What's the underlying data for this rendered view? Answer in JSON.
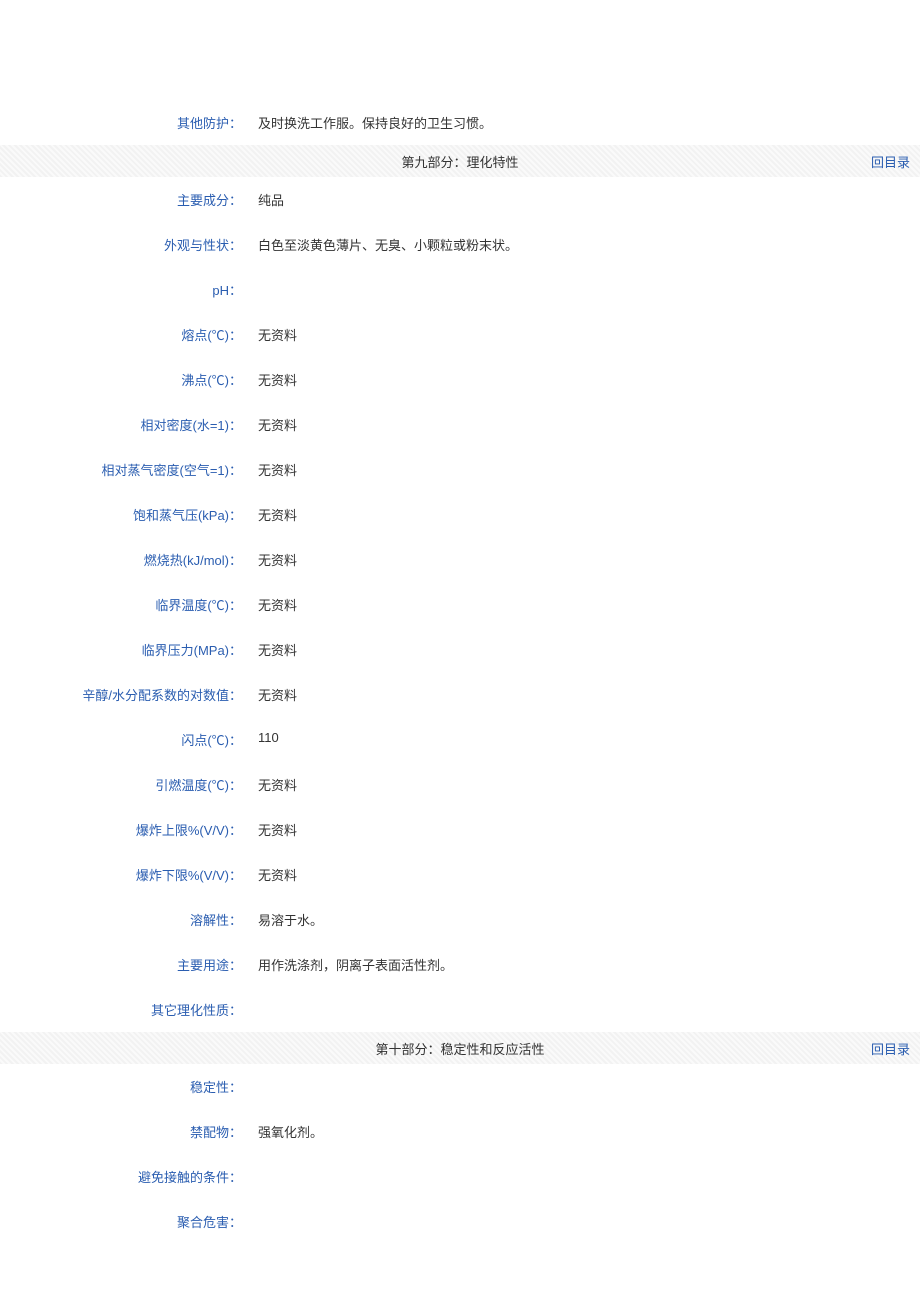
{
  "top_row": {
    "label": "其他防护：",
    "value": "及时换洗工作服。保持良好的卫生习惯。"
  },
  "section9": {
    "title": "第九部分：理化特性",
    "back": "回目录",
    "rows": [
      {
        "label": "主要成分：",
        "value": "纯品"
      },
      {
        "label": "外观与性状：",
        "value": "白色至淡黄色薄片、无臭、小颗粒或粉末状。"
      },
      {
        "label": "pH：",
        "value": ""
      },
      {
        "label": "熔点(℃)：",
        "value": "无资料"
      },
      {
        "label": "沸点(℃)：",
        "value": "无资料"
      },
      {
        "label": "相对密度(水=1)：",
        "value": "无资料"
      },
      {
        "label": "相对蒸气密度(空气=1)：",
        "value": "无资料"
      },
      {
        "label": "饱和蒸气压(kPa)：",
        "value": "无资料"
      },
      {
        "label": "燃烧热(kJ/mol)：",
        "value": "无资料"
      },
      {
        "label": "临界温度(℃)：",
        "value": "无资料"
      },
      {
        "label": "临界压力(MPa)：",
        "value": "无资料"
      },
      {
        "label": "辛醇/水分配系数的对数值：",
        "value": "无资料"
      },
      {
        "label": "闪点(℃)：",
        "value": "110"
      },
      {
        "label": "引燃温度(℃)：",
        "value": "无资料"
      },
      {
        "label": "爆炸上限%(V/V)：",
        "value": "无资料"
      },
      {
        "label": "爆炸下限%(V/V)：",
        "value": "无资料"
      },
      {
        "label": "溶解性：",
        "value": "易溶于水。"
      },
      {
        "label": "主要用途：",
        "value": "用作洗涤剂，阴离子表面活性剂。"
      },
      {
        "label": "其它理化性质：",
        "value": ""
      }
    ]
  },
  "section10": {
    "title": "第十部分：稳定性和反应活性",
    "back": "回目录",
    "rows": [
      {
        "label": "稳定性：",
        "value": ""
      },
      {
        "label": "禁配物：",
        "value": "强氧化剂。"
      },
      {
        "label": "避免接触的条件：",
        "value": ""
      },
      {
        "label": "聚合危害：",
        "value": ""
      }
    ]
  }
}
